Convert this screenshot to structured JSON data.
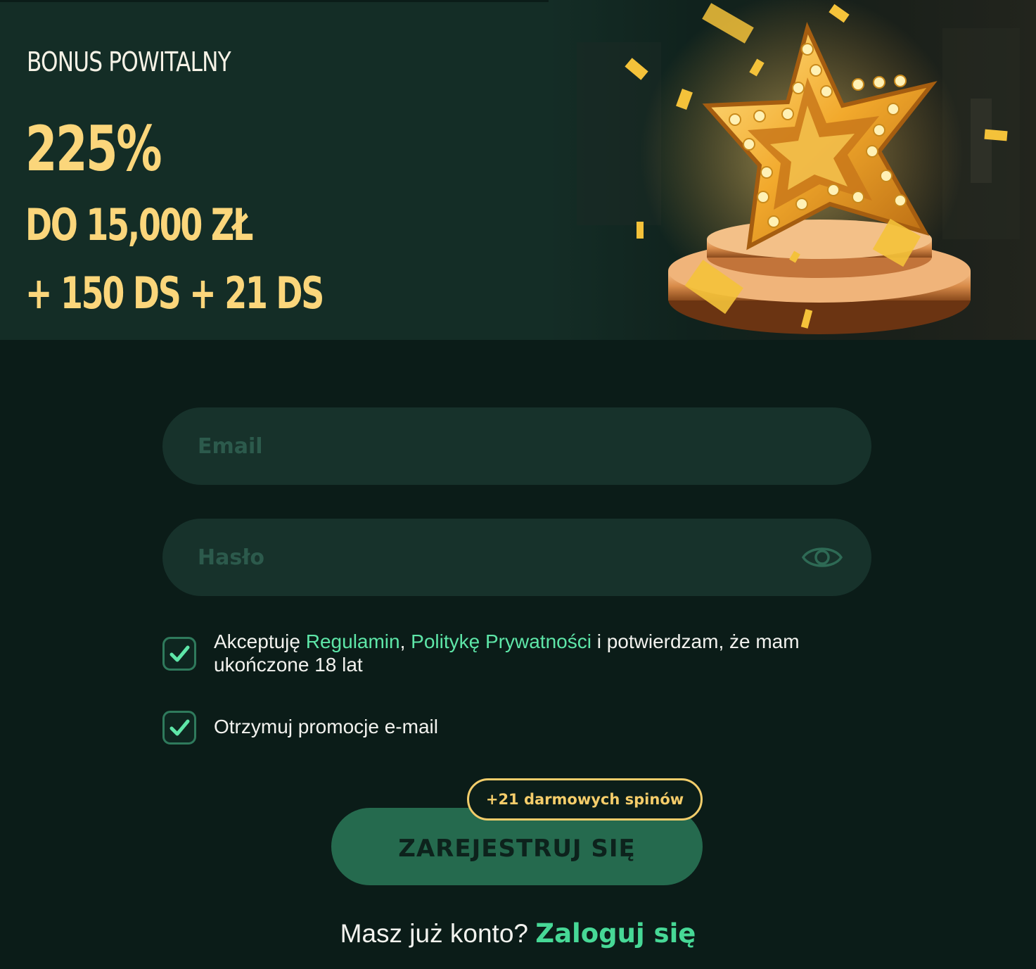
{
  "banner": {
    "title": "BONUS POWITALNY",
    "percent": "225%",
    "amount": "DO 15,000 ZŁ",
    "spins": "+ 150 DS + 21 DS",
    "illustration": "gold-star-trophy-icon"
  },
  "form": {
    "email": {
      "placeholder": "Email",
      "value": ""
    },
    "password": {
      "placeholder": "Hasło",
      "value": "",
      "toggle_icon": "eye-icon"
    },
    "terms": {
      "checked": true,
      "prefix": "Akceptuję ",
      "link_terms": "Regulamin",
      "separator": ", ",
      "link_privacy": "Politykę Prywatności",
      "suffix": " i potwierdzam, że mam ukończone 18 lat"
    },
    "promo": {
      "checked": true,
      "label": "Otrzymuj promocje e-mail"
    },
    "register_label": "ZAREJESTRUJ SIĘ",
    "badge_label": "+21 darmowych spinów"
  },
  "footer": {
    "question": "Masz już konto?",
    "login_link": "Zaloguj się"
  },
  "colors": {
    "accent_green": "#5ee6a8",
    "gold": "#fbd67b",
    "button": "#256a4e",
    "field": "#17322b",
    "background": "#0b1c18"
  }
}
